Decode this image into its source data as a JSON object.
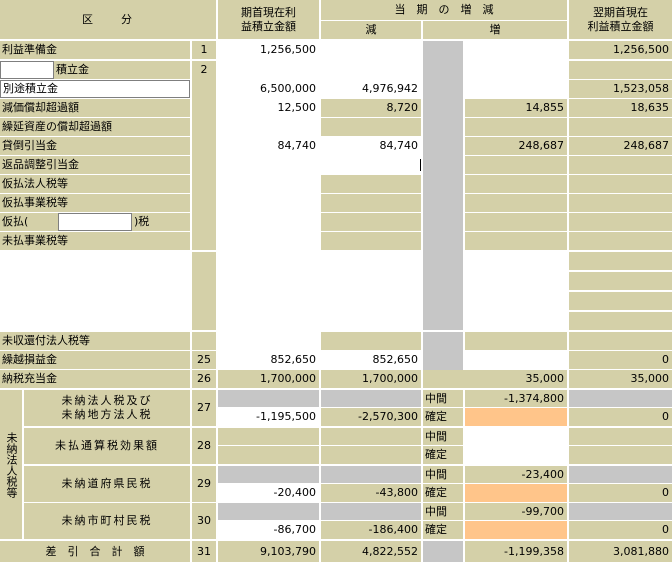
{
  "header": {
    "kubun": "区　　分",
    "kishu_line1": "期首現在利",
    "kishu_line2": "益積立金額",
    "touki": "当　期　の　増　減",
    "gen": "減",
    "zou": "増",
    "yokuki_line1": "翌期首現在",
    "yokuki_line2": "利益積立金額"
  },
  "rows": {
    "r1": {
      "label": "利益準備金",
      "no": "1",
      "kishu": "1,256,500",
      "gen": "",
      "zou": "",
      "yokuki": "1,256,500"
    },
    "r2": {
      "label": "積立金",
      "no": "2"
    },
    "r3": {
      "label": "別途積立金",
      "kishu": "6,500,000",
      "gen": "4,976,942",
      "yokuki": "1,523,058"
    },
    "r4": {
      "label": "減価償却超過額",
      "kishu": "12,500",
      "gen": "8,720",
      "zou": "14,855",
      "yokuki": "18,635"
    },
    "r5": {
      "label": "繰延資産の償却超過額"
    },
    "r6": {
      "label": "貸倒引当金",
      "kishu": "84,740",
      "gen": "84,740",
      "zou": "248,687",
      "yokuki": "248,687"
    },
    "r7": {
      "label": "返品調整引当金"
    },
    "r8": {
      "label": "仮払法人税等"
    },
    "r9": {
      "label": "仮払事業税等"
    },
    "r10": {
      "label_prefix": "仮払(",
      "label_suffix": ")税"
    },
    "r11": {
      "label": "未払事業税等"
    },
    "r12": {
      "label": "未収還付法人税等"
    },
    "r13": {
      "label": "繰越損益金",
      "no": "25",
      "kishu": "852,650",
      "gen": "852,650",
      "yokuki": "0"
    },
    "r14": {
      "label": "納税充当金",
      "no": "26",
      "kishu": "1,700,000",
      "gen": "1,700,000",
      "zou": "35,000",
      "yokuki": "35,000"
    }
  },
  "minou": {
    "group_label": "未納法人税等",
    "hojin": {
      "line1": "未納法人税及び",
      "line2": "未納地方法人税",
      "no": "27",
      "kishu": "-1,195,500",
      "gen": "-2,570,300",
      "chukan_label": "中間",
      "chukan": "-1,374,800",
      "kakutei_label": "確定",
      "yokuki": "0"
    },
    "tsusan": {
      "label": "未払通算税効果額",
      "no": "28",
      "chukan_label": "中間",
      "kakutei_label": "確定"
    },
    "dofuken": {
      "label": "未納道府県民税",
      "no": "29",
      "kishu": "-20,400",
      "gen": "-43,800",
      "chukan_label": "中間",
      "chukan": "-23,400",
      "kakutei_label": "確定",
      "yokuki": "0"
    },
    "shichoson": {
      "label": "未納市町村民税",
      "no": "30",
      "kishu": "-86,700",
      "gen": "-186,400",
      "chukan_label": "中間",
      "chukan": "-99,700",
      "kakutei_label": "確定",
      "yokuki": "0"
    }
  },
  "total": {
    "label": "差　引　合　計　額",
    "no": "31",
    "kishu": "9,103,790",
    "gen": "4,822,552",
    "zou": "-1,199,358",
    "yokuki": "3,081,880"
  },
  "colors": {
    "tan": "#d4d0a8",
    "white": "#ffffff",
    "gray": "#c6c6c6",
    "orange": "#ffc58a"
  }
}
